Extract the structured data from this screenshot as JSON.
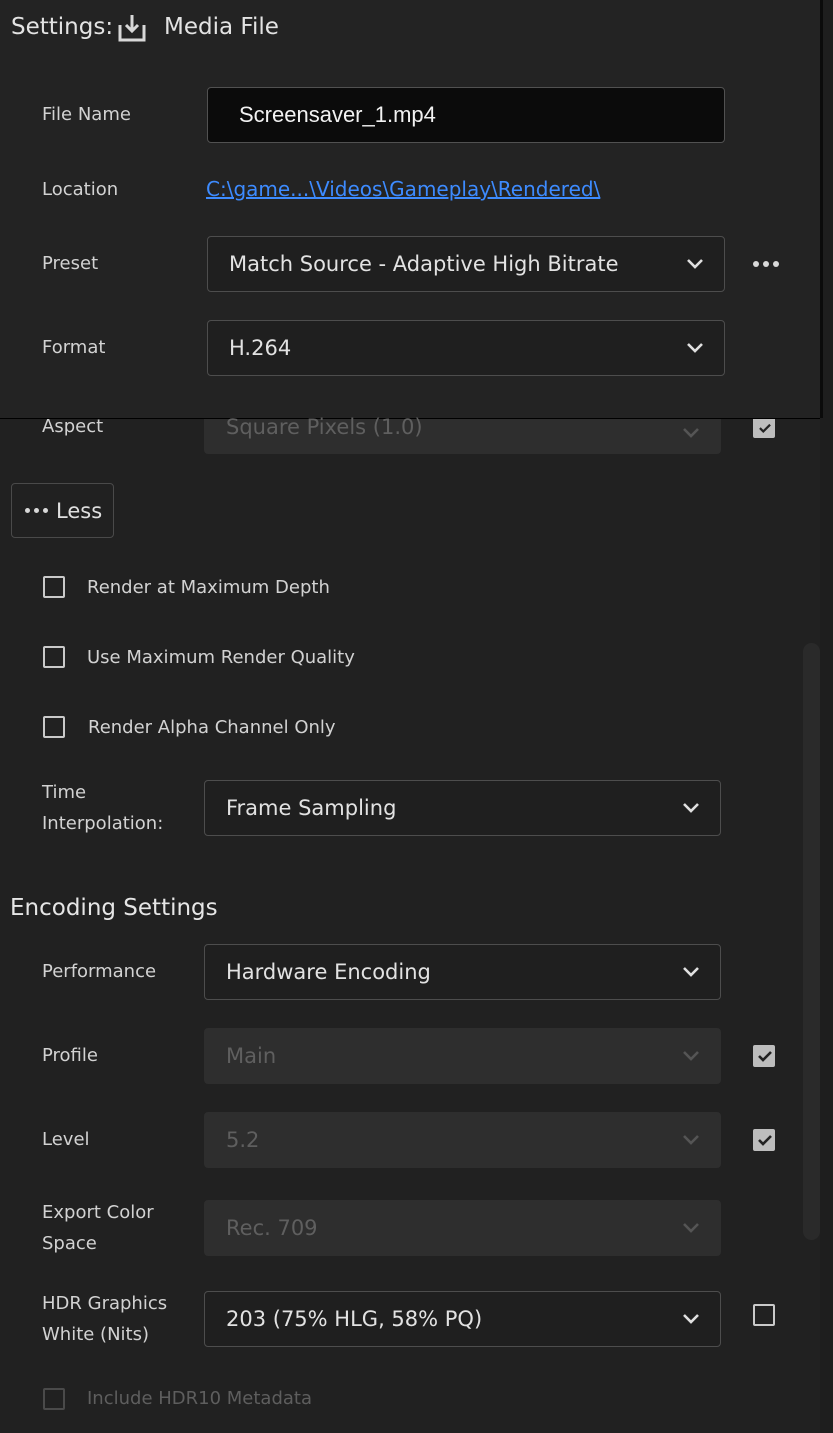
{
  "header": {
    "title": "Settings:",
    "tab_label": "Media File",
    "tab_icon": "download-icon"
  },
  "file_name": {
    "label": "File Name",
    "value": "Screensaver_1.mp4"
  },
  "location": {
    "label": "Location",
    "value": "C:\\game...\\Videos\\Gameplay\\Rendered\\"
  },
  "preset": {
    "label": "Preset",
    "value": "Match Source - Adaptive High Bitrate"
  },
  "format": {
    "label": "Format",
    "value": "H.264"
  },
  "aspect": {
    "label": "Aspect",
    "value": "Square Pixels (1.0)",
    "checked": true
  },
  "less_button": {
    "label": "Less"
  },
  "options": [
    {
      "label": "Render at Maximum Depth",
      "checked": false
    },
    {
      "label": "Use Maximum Render Quality",
      "checked": false
    },
    {
      "label": "Render Alpha Channel Only",
      "checked": false
    }
  ],
  "time_interpolation": {
    "label_line1": "Time",
    "label_line2": "Interpolation:",
    "value": "Frame Sampling"
  },
  "encoding": {
    "title": "Encoding Settings",
    "performance": {
      "label": "Performance",
      "value": "Hardware Encoding"
    },
    "profile": {
      "label": "Profile",
      "value": "Main",
      "checked": true
    },
    "level": {
      "label": "Level",
      "value": "5.2",
      "checked": true
    },
    "color_space": {
      "label_line1": "Export Color",
      "label_line2": "Space",
      "value": "Rec. 709"
    },
    "hdr_white": {
      "label_line1": "HDR Graphics",
      "label_line2": "White (Nits)",
      "value": "203 (75% HLG, 58% PQ)",
      "checked": false
    },
    "hdr10": {
      "label": "Include HDR10 Metadata",
      "checked": false
    }
  },
  "colors": {
    "background": "#212121",
    "link": "#3d8bff",
    "field_bg": "#1f1f1f",
    "disabled_bg": "#2e2e2e"
  }
}
